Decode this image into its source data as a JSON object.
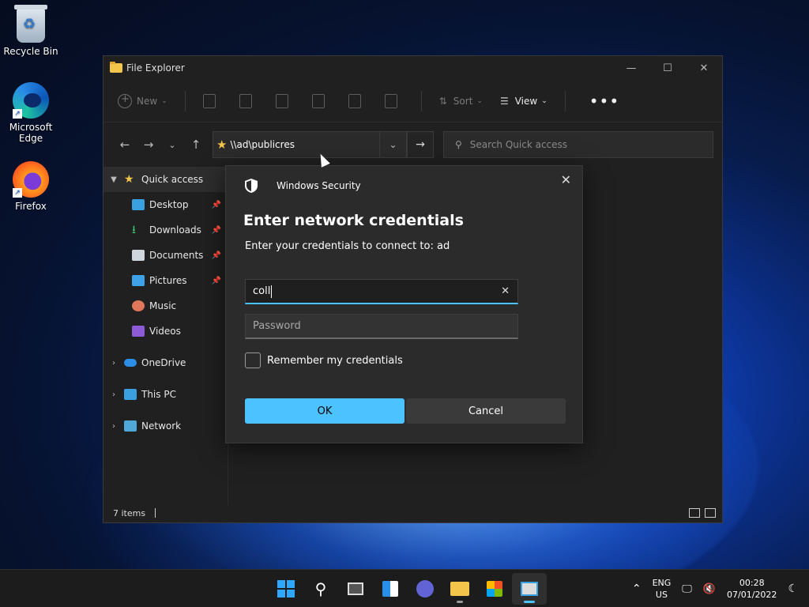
{
  "desktop": {
    "icons": [
      {
        "label": "Recycle Bin"
      },
      {
        "label": "Microsoft Edge"
      },
      {
        "label": "Firefox"
      }
    ]
  },
  "explorer": {
    "title": "File Explorer",
    "toolbar": {
      "new_label": "New",
      "sort_label": "Sort",
      "view_label": "View",
      "more_label": "•••"
    },
    "address": {
      "path": "\\\\ad\\publicres"
    },
    "search": {
      "placeholder": "Search Quick access"
    },
    "sidebar": {
      "quick_access": "Quick access",
      "items": [
        {
          "label": "Desktop"
        },
        {
          "label": "Downloads"
        },
        {
          "label": "Documents"
        },
        {
          "label": "Pictures"
        },
        {
          "label": "Music"
        },
        {
          "label": "Videos"
        }
      ],
      "onedrive": "OneDrive",
      "this_pc": "This PC",
      "network": "Network"
    },
    "status": {
      "items_count": "7 items"
    }
  },
  "dialog": {
    "app_name": "Windows Security",
    "title": "Enter network credentials",
    "subtitle": "Enter your credentials to connect to: ad",
    "username_value": "coll",
    "password_placeholder": "Password",
    "remember_label": "Remember my credentials",
    "ok_label": "OK",
    "cancel_label": "Cancel"
  },
  "taskbar": {
    "lang_top": "ENG",
    "lang_bottom": "US",
    "time": "00:28",
    "date": "07/01/2022"
  },
  "colors": {
    "accent": "#4cc2ff"
  }
}
